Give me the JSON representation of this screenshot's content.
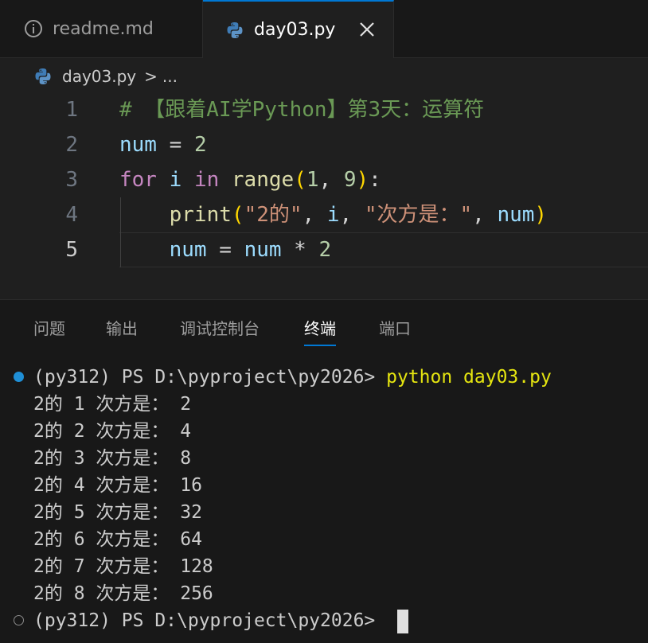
{
  "tabs": [
    {
      "label": "readme.md",
      "icon": "info-icon",
      "active": false
    },
    {
      "label": "day03.py",
      "icon": "python-icon",
      "active": true
    }
  ],
  "breadcrumb": {
    "file": "day03.py",
    "separator": ">",
    "more": "..."
  },
  "editor": {
    "line_numbers": [
      "1",
      "2",
      "3",
      "4",
      "5"
    ],
    "current_line": "5",
    "lines": [
      [
        {
          "t": "# 【跟着AI学Python】第3天：运算符",
          "c": "comment"
        }
      ],
      [
        {
          "t": "num",
          "c": "var"
        },
        {
          "t": " = ",
          "c": "op"
        },
        {
          "t": "2",
          "c": "num"
        }
      ],
      [
        {
          "t": "for",
          "c": "kw"
        },
        {
          "t": " ",
          "c": "op"
        },
        {
          "t": "i",
          "c": "var"
        },
        {
          "t": " ",
          "c": "op"
        },
        {
          "t": "in",
          "c": "kw"
        },
        {
          "t": " ",
          "c": "op"
        },
        {
          "t": "range",
          "c": "fn"
        },
        {
          "t": "(",
          "c": "br1"
        },
        {
          "t": "1",
          "c": "num"
        },
        {
          "t": ", ",
          "c": "op"
        },
        {
          "t": "9",
          "c": "num"
        },
        {
          "t": ")",
          "c": "br1"
        },
        {
          "t": ":",
          "c": "op"
        }
      ],
      [
        {
          "t": "    ",
          "c": "op"
        },
        {
          "t": "print",
          "c": "fn"
        },
        {
          "t": "(",
          "c": "br1"
        },
        {
          "t": "\"2的\"",
          "c": "str"
        },
        {
          "t": ", ",
          "c": "op"
        },
        {
          "t": "i",
          "c": "var"
        },
        {
          "t": ", ",
          "c": "op"
        },
        {
          "t": "\"次方是：\"",
          "c": "str"
        },
        {
          "t": ", ",
          "c": "op"
        },
        {
          "t": "num",
          "c": "var"
        },
        {
          "t": ")",
          "c": "br1"
        }
      ],
      [
        {
          "t": "    ",
          "c": "op"
        },
        {
          "t": "num",
          "c": "var"
        },
        {
          "t": " = ",
          "c": "op"
        },
        {
          "t": "num",
          "c": "var"
        },
        {
          "t": " * ",
          "c": "op"
        },
        {
          "t": "2",
          "c": "num"
        }
      ]
    ]
  },
  "panel": {
    "tabs": [
      "问题",
      "输出",
      "调试控制台",
      "终端",
      "端口"
    ],
    "active_tab": "终端"
  },
  "terminal": {
    "prompt": "(py312) PS D:\\pyproject\\py2026> ",
    "command": "python day03.py",
    "output": [
      "2的 1 次方是： 2",
      "2的 2 次方是： 4",
      "2的 3 次方是： 8",
      "2的 4 次方是： 16",
      "2的 5 次方是： 32",
      "2的 6 次方是： 64",
      "2的 7 次方是： 128",
      "2的 8 次方是： 256"
    ],
    "final_prompt": "(py312) PS D:\\pyproject\\py2026> "
  },
  "colors": {
    "accent": "#0078d4",
    "background": "#1f1f1f",
    "python_blue": "#3f7cb6",
    "python_yellow": "#ffd43b"
  }
}
